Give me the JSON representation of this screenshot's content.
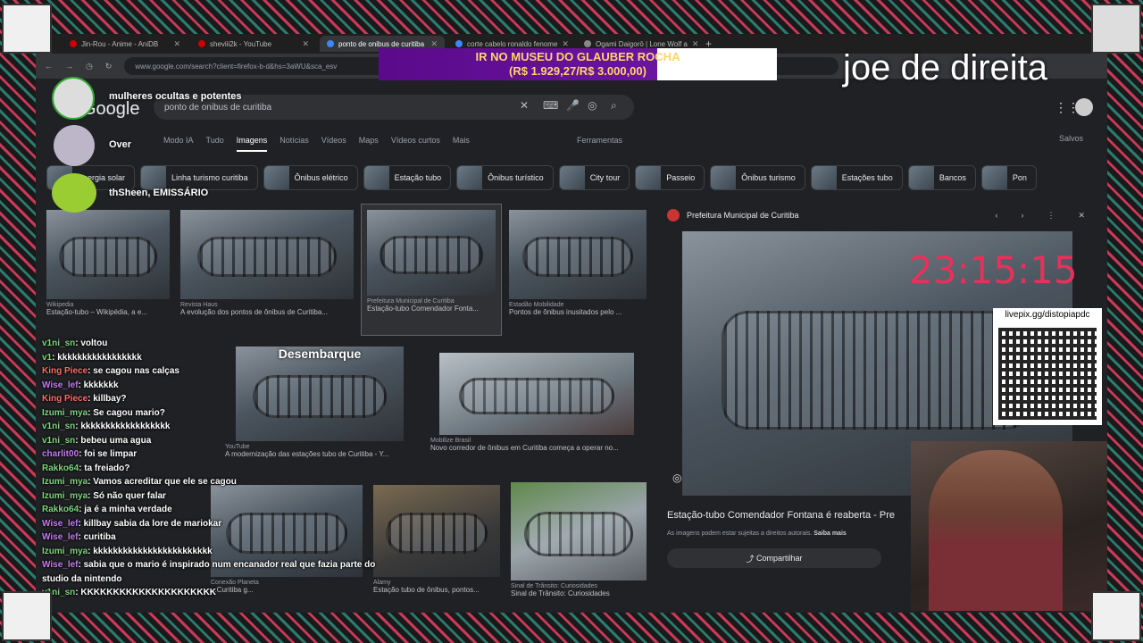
{
  "browser": {
    "tabs": [
      {
        "label": "Jin-Rou - Anime - AniDB"
      },
      {
        "label": "sheviii2k - YouTube"
      },
      {
        "label": "ponto de onibus de curitiba"
      },
      {
        "label": "corte cabelo ronaldo fenome"
      },
      {
        "label": "Ogami Daigorō | Lone Wolf a"
      }
    ],
    "url": "www.google.com/search?client=firefox-b-d&hs=3aWU&sca_esv"
  },
  "google": {
    "logo": "Google",
    "query": "ponto de onibus de curitiba",
    "nav": [
      "Modo IA",
      "Tudo",
      "Imagens",
      "Notícias",
      "Vídeos",
      "Maps",
      "Vídeos curtos",
      "Mais"
    ],
    "tools": "Ferramentas",
    "saved": "Salvos",
    "chips": [
      "Energia solar",
      "Linha turismo curitiba",
      "Ônibus elétrico",
      "Estação tubo",
      "Ônibus turístico",
      "City tour",
      "Passeio",
      "Ônibus turismo",
      "Estações tubo",
      "Bancos",
      "Pon"
    ]
  },
  "results": [
    {
      "source": "Wikipedia",
      "caption": "Estação-tubo – Wikipédia, a e..."
    },
    {
      "source": "Revista Haus",
      "caption": "A evolução dos pontos de ônibus de Curitiba..."
    },
    {
      "source": "Prefeitura Municipal de Curitiba",
      "caption": "Estação-tubo Comendador Fonta..."
    },
    {
      "source": "Estadão Mobilidade",
      "caption": "Pontos de ônibus inusitados pelo ..."
    },
    {
      "source": "YouTube",
      "caption": "A modernização das estações tubo de Curitiba - Y..."
    },
    {
      "source": "Mobilize Brasil",
      "caption": "Novo corredor de ônibus em Curitiba começa a operar no..."
    },
    {
      "source": "Conexão Planeta",
      "caption": "...Curitiba g..."
    },
    {
      "source": "Alamy",
      "caption": "Estação tubo de ônibus, pontos..."
    },
    {
      "source": "Sinal de Trânsito: Curiosidades",
      "caption": "Sinal de Trânsito: Curiosidades"
    }
  ],
  "overlay_text": "Desembarque",
  "panel": {
    "source": "Prefeitura Municipal de Curitiba",
    "title": "Estação-tubo Comendador Fontana é reaberta - Pre",
    "note": "As imagens podem estar sujeitas a direitos autorais.",
    "note_link": "Saiba mais",
    "share": "Compartilhar"
  },
  "stream": {
    "banner_line1": "IR NO MUSEU DO GLAUBER ROCHA",
    "banner_line2": "(R$ 1.929,27/R$ 3.000,00)",
    "handle": "joe de direita",
    "clock": "23:15:15",
    "qr_label": "livepix.gg/distopiapdc",
    "side_users": [
      "mulheres ocultas e potentes",
      "Over",
      "thSheen, EMISSÁRIO"
    ]
  },
  "chat": [
    {
      "user": "v1ni_sn",
      "msg": "voltou"
    },
    {
      "user": "v1",
      "msg": "kkkkkkkkkkkkkkkkk"
    },
    {
      "user": "King Piece",
      "msg": "se cagou nas calças"
    },
    {
      "user": "Wise_lef",
      "msg": "kkkkkkk"
    },
    {
      "user": "King Piece",
      "msg": "killbay?"
    },
    {
      "user": "Izumi_mya",
      "msg": "Se cagou mario?"
    },
    {
      "user": "v1ni_sn",
      "msg": "kkkkkkkkkkkkkkkkkk"
    },
    {
      "user": "v1ni_sn",
      "msg": "bebeu uma agua"
    },
    {
      "user": "charlit00",
      "msg": "foi se limpar"
    },
    {
      "user": "Rakko64",
      "msg": "ta freiado?"
    },
    {
      "user": "Izumi_mya",
      "msg": "Vamos acreditar que ele se cagou"
    },
    {
      "user": "Izumi_mya",
      "msg": "Só não quer falar"
    },
    {
      "user": "Rakko64",
      "msg": "ja é a minha verdade"
    },
    {
      "user": "Wise_lef",
      "msg": "killbay sabia da lore de mariokar"
    },
    {
      "user": "Wise_lef",
      "msg": "curitiba"
    },
    {
      "user": "Izumi_mya",
      "msg": "kkkkkkkkkkkkkkkkkkkkkkkk"
    },
    {
      "user": "Wise_lef",
      "msg": "sabia que o mario é inspirado num encanador real que fazia parte do studio da nintendo"
    },
    {
      "user": "v1ni_sn",
      "msg": "KKKKKKKKKKKKKKKKKKKKK"
    }
  ]
}
